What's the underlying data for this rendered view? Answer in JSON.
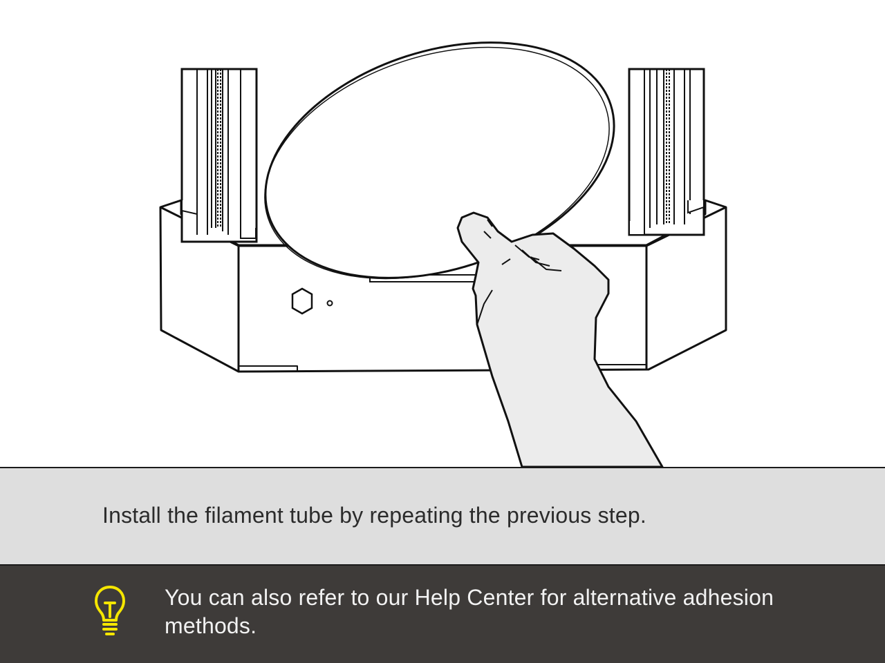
{
  "illustration": {
    "subject": "printer-base-with-build-plate-and-hand",
    "line_color": "#111111",
    "fill_color": "#ffffff",
    "hand_fill": "#ececec"
  },
  "instruction": {
    "text": "Install the filament tube by repeating the previous step.",
    "background": "#dedede"
  },
  "tip": {
    "icon": "lightbulb-icon",
    "icon_color": "#f5e600",
    "text": "You can also refer to our Help Center for alternative adhesion methods.",
    "background": "#3e3b39"
  }
}
